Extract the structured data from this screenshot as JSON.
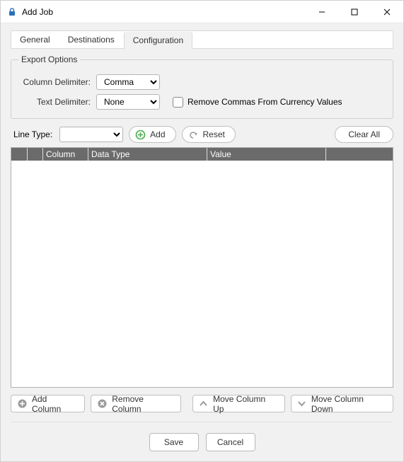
{
  "window": {
    "title": "Add Job"
  },
  "tabs": {
    "general": "General",
    "destinations": "Destinations",
    "configuration": "Configuration",
    "active": "configuration"
  },
  "exportOptions": {
    "legend": "Export Options",
    "columnDelimiterLabel": "Column Delimiter:",
    "columnDelimiterValue": "Comma",
    "textDelimiterLabel": "Text Delimiter:",
    "textDelimiterValue": "None",
    "removeCommasLabel": "Remove Commas From Currency Values",
    "removeCommasChecked": false
  },
  "lineType": {
    "label": "Line Type:",
    "value": ""
  },
  "actions": {
    "add": "Add",
    "reset": "Reset",
    "clearAll": "Clear All"
  },
  "grid": {
    "headers": {
      "column": "Column",
      "dataType": "Data Type",
      "value": "Value"
    },
    "rows": []
  },
  "columnButtons": {
    "addColumn": "Add Column",
    "removeColumn": "Remove Column",
    "moveUp": "Move Column Up",
    "moveDown": "Move Column Down"
  },
  "dialog": {
    "save": "Save",
    "cancel": "Cancel"
  },
  "icons": {
    "lock": "lock-icon",
    "plusCircle": "plus-circle-icon",
    "undo": "undo-icon",
    "plusGray": "plus-gray-icon",
    "xGray": "x-gray-icon",
    "chevUp": "chevron-up-icon",
    "chevDown": "chevron-down-icon"
  },
  "colors": {
    "gridHeader": "#6b6b6b",
    "panelBg": "#f1f1f1",
    "addGreen": "#4caf50",
    "iconGray": "#9a9a9a"
  }
}
